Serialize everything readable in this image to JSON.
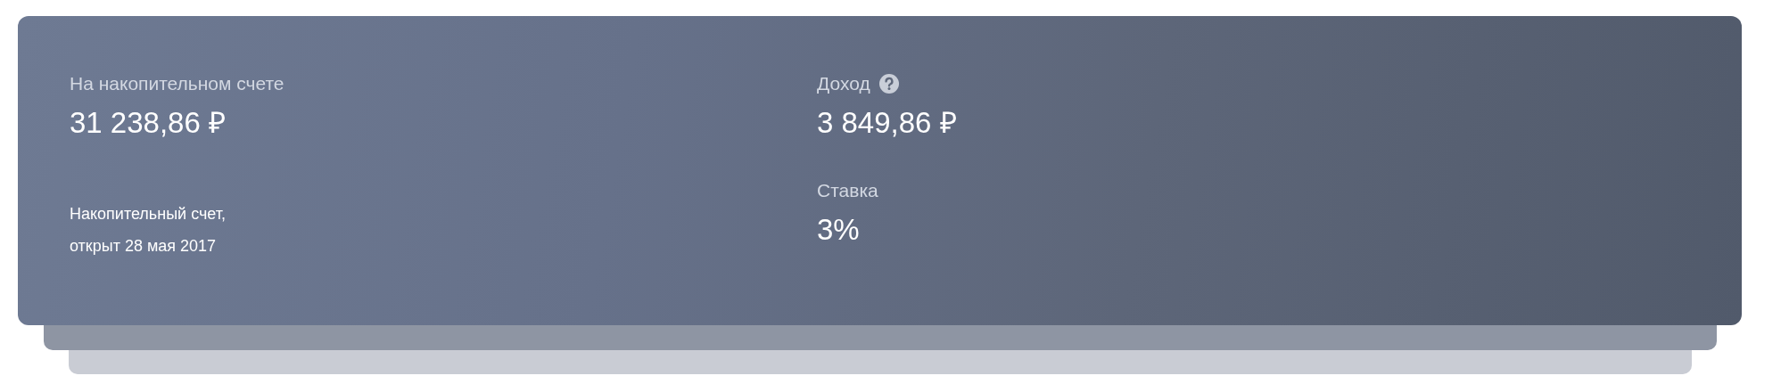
{
  "account": {
    "balance_label": "На накопительном счете",
    "balance": "31 238,86 ₽",
    "description_lines": [
      "Накопительный счет,",
      "открыт 28 мая 2017"
    ]
  },
  "income": {
    "label": "Доход",
    "value": "3 849,86 ₽"
  },
  "rate": {
    "label": "Ставка",
    "value": "3%"
  }
}
